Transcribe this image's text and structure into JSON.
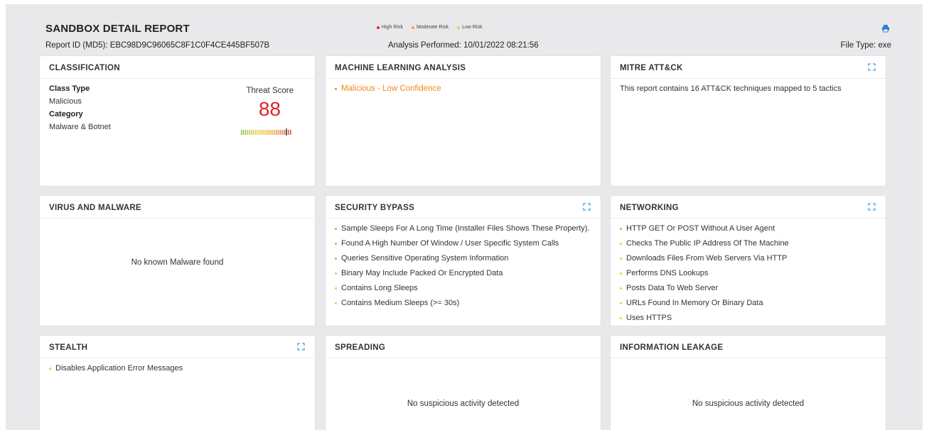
{
  "header": {
    "title": "SANDBOX DETAIL REPORT",
    "report_id": "Report ID (MD5): EBC98D9C96065C8F1C0F4CE445BF507B",
    "analysis": "Analysis Performed: 10/01/2022 08:21:56",
    "file_type": "File Type: exe",
    "legend": {
      "high": "High Risk",
      "moderate": "Moderate Risk",
      "low": "Low Risk"
    },
    "print_icon": "printer-icon"
  },
  "colors": {
    "high": "#e7262b",
    "moderate": "#f0a430",
    "low": "#f5c842",
    "score": "#e0242a",
    "print": "#2f7bd6",
    "expand": "#3aa0e0"
  },
  "classification": {
    "title": "CLASSIFICATION",
    "class_type_label": "Class Type",
    "class_type_value": "Malicious",
    "category_label": "Category",
    "category_value": "Malware & Botnet",
    "threat_score_label": "Threat Score",
    "threat_score": "88",
    "threat_score_fraction": 0.88
  },
  "ml": {
    "title": "MACHINE LEARNING ANALYSIS",
    "item": "Malicious - Low Confidence"
  },
  "mitre": {
    "title": "MITRE ATT&CK",
    "text": "This report contains 16 ATT&CK techniques mapped to 5 tactics"
  },
  "virus": {
    "title": "VIRUS AND MALWARE",
    "message": "No known Malware found"
  },
  "bypass": {
    "title": "SECURITY BYPASS",
    "items": [
      "Sample Sleeps For A Long Time (Installer Files Shows These Property).",
      "Found A High Number Of Window / User Specific System Calls",
      "Queries Sensitive Operating System Information",
      "Binary May Include Packed Or Encrypted Data",
      "Contains Long Sleeps",
      "Contains Medium Sleeps (>= 30s)"
    ]
  },
  "networking": {
    "title": "NETWORKING",
    "items": [
      "HTTP GET Or POST Without A User Agent",
      "Checks The Public IP Address Of The Machine",
      "Downloads Files From Web Servers Via HTTP",
      "Performs DNS Lookups",
      "Posts Data To Web Server",
      "URLs Found In Memory Or Binary Data",
      "Uses HTTPS"
    ]
  },
  "stealth": {
    "title": "STEALTH",
    "items": [
      "Disables Application Error Messages"
    ]
  },
  "spreading": {
    "title": "SPREADING",
    "message": "No suspicious activity detected"
  },
  "leakage": {
    "title": "INFORMATION LEAKAGE",
    "message": "No suspicious activity detected"
  }
}
